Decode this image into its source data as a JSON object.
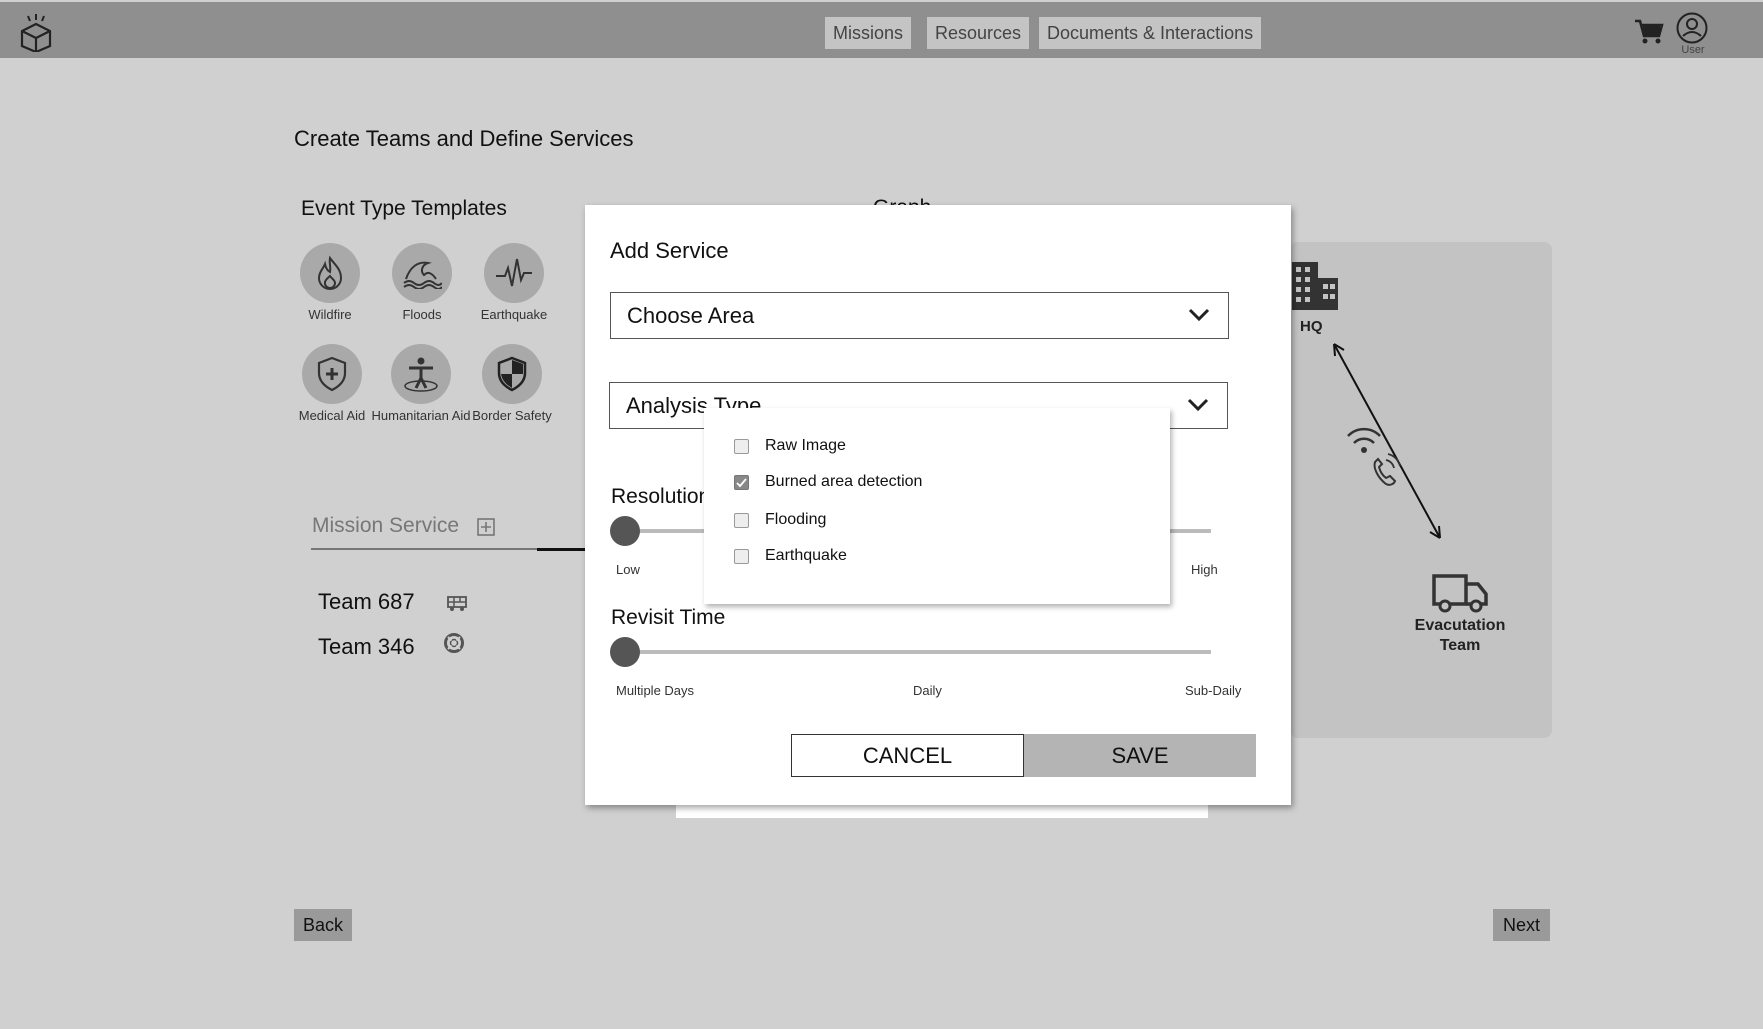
{
  "header": {
    "nav": [
      "Missions",
      "Resources",
      "Documents & Interactions"
    ],
    "user_label": "User"
  },
  "page": {
    "title": "Create Teams and Define Services",
    "templates_title": "Event Type Templates",
    "graph_title": "Graph",
    "templates": [
      {
        "label": "Wildfire",
        "icon": "flame-icon"
      },
      {
        "label": "Floods",
        "icon": "wave-icon"
      },
      {
        "label": "Earthquake",
        "icon": "seismic-icon"
      },
      {
        "label": "Medical Aid",
        "icon": "shield-plus-icon"
      },
      {
        "label": "Humanitarian Aid",
        "icon": "person-icon"
      },
      {
        "label": "Border Safety",
        "icon": "security-shield-icon"
      }
    ],
    "mission_tab": "Mission Service",
    "teams": [
      {
        "name": "Team 687",
        "icon": "fire-truck-icon"
      },
      {
        "name": "Team 346",
        "icon": "lifebuoy-icon"
      }
    ],
    "graph": {
      "hq_label": "HQ",
      "evac_label": "Evacutation Team"
    },
    "back_label": "Back",
    "next_label": "Next"
  },
  "modal": {
    "title": "Add Service",
    "area_select": "Choose Area",
    "analysis_select": "Analysis Type",
    "resolution_label": "Resolution",
    "resolution_ticks": [
      "Low",
      "High"
    ],
    "resolution_value": 0,
    "revisit_label": "Revisit Time",
    "revisit_ticks": [
      "Multiple Days",
      "Daily",
      "Sub-Daily"
    ],
    "revisit_value": 0,
    "cancel_label": "CANCEL",
    "save_label": "SAVE"
  },
  "analysis_options": [
    {
      "label": "Raw Image",
      "checked": false
    },
    {
      "label": "Burned area detection",
      "checked": true
    },
    {
      "label": "Flooding",
      "checked": false
    },
    {
      "label": "Earthquake",
      "checked": false
    }
  ]
}
